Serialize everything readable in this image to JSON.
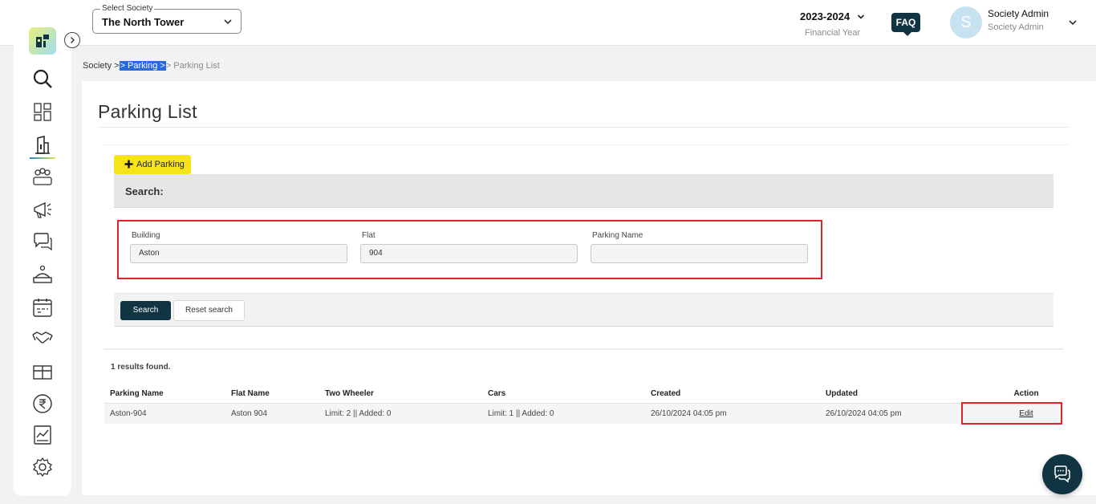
{
  "header": {
    "society_select_label": "Select Society",
    "society_select_value": "The North Tower",
    "financial_year": "2023-2024",
    "financial_year_label": "Financial Year",
    "faq_label": "FAQ",
    "avatar_initial": "S",
    "user_name": "Society Admin",
    "user_role": "Society Admin"
  },
  "sidebar": {
    "icons": [
      "search-icon",
      "dashboard-icon",
      "building-icon",
      "members-icon",
      "announcement-icon",
      "chat-icon",
      "service-icon",
      "calendar-icon",
      "handshake-icon",
      "gift-icon",
      "rupee-icon",
      "report-chart-icon",
      "settings-gear-icon"
    ],
    "active": "building-icon"
  },
  "breadcrumb": {
    "root": "Society",
    "sep1": " >",
    "middle": "> Parking >",
    "current": "> Parking List"
  },
  "page": {
    "title": "Parking List",
    "add_button": "Add Parking",
    "search_heading": "Search:"
  },
  "filters": {
    "building": {
      "label": "Building",
      "value": "Aston"
    },
    "flat": {
      "label": "Flat",
      "value": "904"
    },
    "parking_name": {
      "label": "Parking Name",
      "value": ""
    }
  },
  "actions": {
    "search": "Search",
    "reset": "Reset search"
  },
  "results": {
    "count_text": "1 results found.",
    "columns": [
      "Parking Name",
      "Flat Name",
      "Two Wheeler",
      "Cars",
      "Created",
      "Updated",
      "Action"
    ],
    "rows": [
      {
        "parking_name": "Aston-904",
        "flat_name": "Aston 904",
        "two_wheeler": "Limit: 2 || Added: 0",
        "cars": "Limit: 1 || Added: 0",
        "created": "26/10/2024 04:05 pm",
        "updated": "26/10/2024 04:05 pm",
        "action": "Edit"
      }
    ]
  },
  "colors": {
    "brand_dark": "#113442",
    "add_button_yellow": "#f7e31a",
    "highlight_red": "#d62828",
    "breadcrumb_highlight": "#2a6ae0"
  }
}
